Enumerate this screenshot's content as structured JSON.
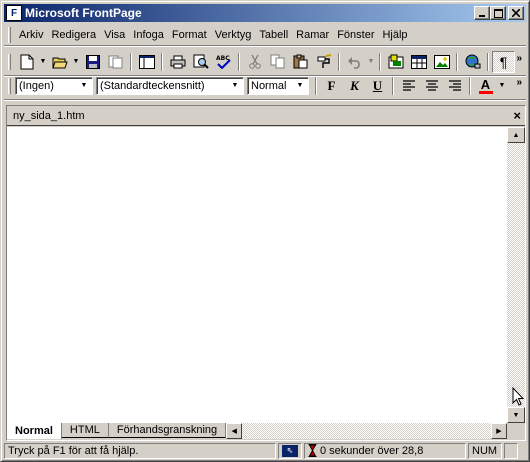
{
  "window": {
    "title": "Microsoft FrontPage",
    "app_icon": "frontpage-icon"
  },
  "menu": {
    "items": [
      {
        "label": "Arkiv"
      },
      {
        "label": "Redigera"
      },
      {
        "label": "Visa"
      },
      {
        "label": "Infoga"
      },
      {
        "label": "Format"
      },
      {
        "label": "Verktyg"
      },
      {
        "label": "Tabell"
      },
      {
        "label": "Ramar"
      },
      {
        "label": "Fönster"
      },
      {
        "label": "Hjälp"
      }
    ]
  },
  "toolbar_format": {
    "style": "(Ingen)",
    "font": "(Standardteckensnitt)",
    "size": "Normal",
    "bold": "F",
    "italic": "K",
    "underline": "U",
    "font_color_letter": "A",
    "font_color": "#ff0000"
  },
  "document": {
    "filename": "ny_sida_1.htm",
    "close_glyph": "×",
    "tabs": [
      {
        "label": "Normal",
        "active": true
      },
      {
        "label": "HTML",
        "active": false
      },
      {
        "label": "Förhandsgranskning",
        "active": false
      }
    ]
  },
  "status": {
    "hint": "Tryck på F1 för att få hjälp.",
    "timing": "0 sekunder över 28,8",
    "num": "NUM"
  },
  "colors": {
    "title_start": "#0a246a",
    "title_end": "#a6caf0",
    "face": "#d4d0c8"
  }
}
